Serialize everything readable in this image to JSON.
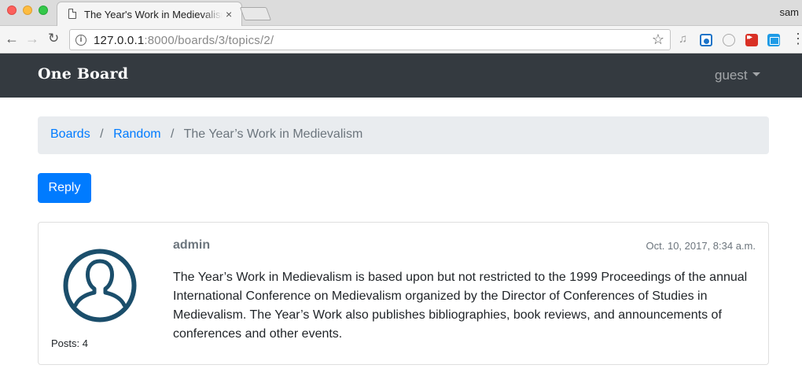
{
  "browser": {
    "tab_title": "The Year's Work in Medievalism",
    "tab_close": "×",
    "profile_name": "sam",
    "url_host": "127.0.0.1",
    "url_rest": ":8000/boards/3/topics/2/",
    "back": "←",
    "forward": "→",
    "reload": "↻",
    "star": "☆",
    "menu": "⋮",
    "info": "i",
    "music": "♫"
  },
  "navbar": {
    "brand": "One Board",
    "user": "guest"
  },
  "breadcrumb": {
    "items": [
      "Boards",
      "Random",
      "The Year’s Work in Medievalism"
    ],
    "separator": "/"
  },
  "actions": {
    "reply_label": "Reply"
  },
  "post": {
    "author": "admin",
    "date": "Oct. 10, 2017, 8:34 a.m.",
    "body": "The Year’s Work in Medievalism is based upon but not restricted to the 1999 Proceedings of the annual International Conference on Medievalism organized by the Director of Conferences of Studies in Medievalism. The Year’s Work also publishes bibliographies, book reviews, and announcements of conferences and other events.",
    "posts_label": "Posts: 4"
  },
  "colors": {
    "navbar_bg": "#343a40",
    "link": "#007bff",
    "primary_button": "#007bff",
    "avatar_stroke": "#1b4e6b"
  }
}
